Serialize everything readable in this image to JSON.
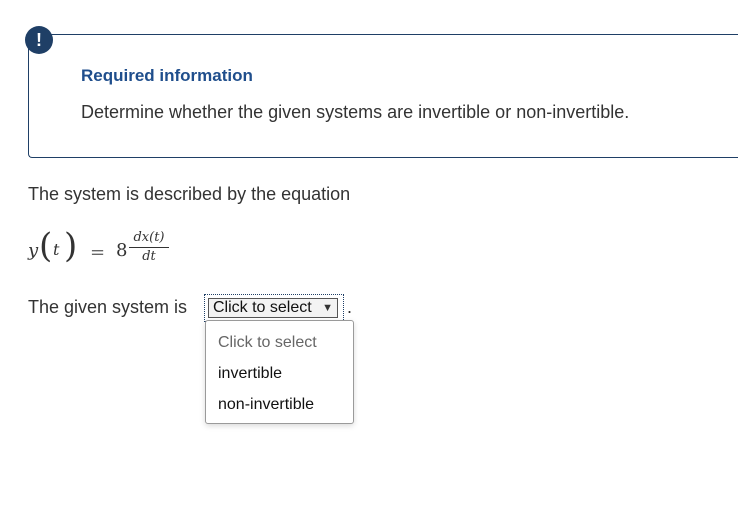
{
  "info_box": {
    "badge": "!",
    "title": "Required information",
    "description": "Determine whether the given systems are invertible or non-invertible."
  },
  "question": {
    "system_text": "The system is described by the equation",
    "equation": {
      "lhs_function": "y",
      "lhs_variable": "t",
      "equals": "=",
      "coefficient": "8",
      "numerator": "dx(t)",
      "denominator": "dt"
    },
    "given_prefix": "The given system is",
    "period": "."
  },
  "select": {
    "selected": "Click to select",
    "options": [
      "Click to select",
      "invertible",
      "non-invertible"
    ]
  },
  "colors": {
    "brand_navy": "#1f3f66",
    "title_blue": "#1f4e8c"
  },
  "icons": {
    "badge": "alert-icon",
    "dropdown": "chevron-down-icon"
  }
}
